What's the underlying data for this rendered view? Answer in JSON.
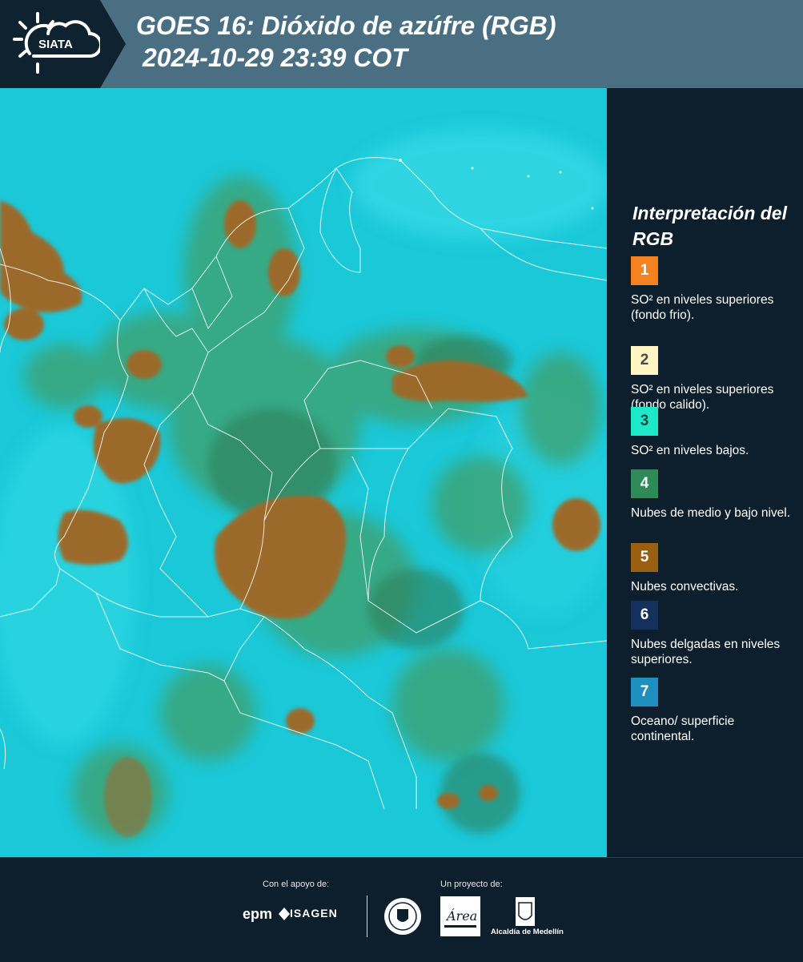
{
  "header": {
    "brand": "SIATA",
    "title_line1": "GOES 16: Dióxido de azúfre (RGB)",
    "title_line2": "2024-10-29 23:39 COT"
  },
  "legend": {
    "title": "Interpretación del RGB",
    "items": [
      {
        "number": "1",
        "color": "#f58220",
        "text_color": "#ffffff",
        "text": "SO² en niveles superiores (fondo frio)."
      },
      {
        "number": "2",
        "color": "#fdf6c3",
        "text_color": "#4a4a4a",
        "text": "SO² en niveles superiores (fondo calido)."
      },
      {
        "number": "3",
        "color": "#1de9c9",
        "text_color": "#1a4a44",
        "text": "SO² en niveles bajos."
      },
      {
        "number": "4",
        "color": "#2e8b57",
        "text_color": "#ffffff",
        "text": "Nubes de medio y bajo nivel."
      },
      {
        "number": "5",
        "color": "#9b5f12",
        "text_color": "#ffffff",
        "text": "Nubes convectivas."
      },
      {
        "number": "6",
        "color": "#13315c",
        "text_color": "#ffffff",
        "text": "Nubes delgadas en niveles superiores."
      },
      {
        "number": "7",
        "color": "#1e8fbf",
        "text_color": "#ffffff",
        "text": "Oceano/ superficie continental."
      }
    ]
  },
  "footer": {
    "support_label": "Con el apoyo de:",
    "project_label": "Un proyecto de:",
    "sponsor1": "epm",
    "sponsor2": "ISAGEN",
    "partner1": "Área Metropolitana",
    "partner2": "Alcaldía de Medellín"
  },
  "map_colors": {
    "background": "#19c6d6",
    "convective": "#9b6a2c",
    "mid_low_cloud": "#3f9f6a",
    "border_lines": "#ffffff"
  }
}
